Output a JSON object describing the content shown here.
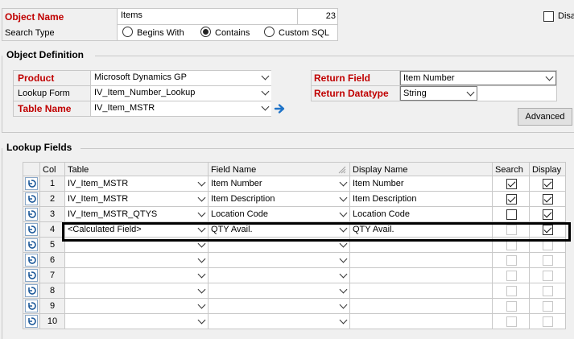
{
  "header": {
    "object_name_label": "Object Name",
    "object_name_value": "Items",
    "object_name_count": "23",
    "search_type_label": "Search Type",
    "search_options": [
      {
        "label": "Begins With",
        "selected": false
      },
      {
        "label": "Contains",
        "selected": true
      },
      {
        "label": "Custom SQL",
        "selected": false
      }
    ],
    "disable_label": "Disa",
    "disable_checked": false
  },
  "object_definition": {
    "title": "Object Definition",
    "product_label": "Product",
    "product_value": "Microsoft Dynamics GP",
    "lookup_form_label": "Lookup Form",
    "lookup_form_value": "IV_Item_Number_Lookup",
    "table_name_label": "Table Name",
    "table_name_value": "IV_Item_MSTR",
    "return_field_label": "Return Field",
    "return_field_value": "Item Number",
    "return_datatype_label": "Return Datatype",
    "return_datatype_value": "String",
    "advanced_label": "Advanced"
  },
  "lookup_fields": {
    "title": "Lookup Fields",
    "columns": {
      "col": "Col",
      "table": "Table",
      "field": "Field Name",
      "display_name": "Display Name",
      "search": "Search",
      "display": "Display"
    },
    "rows": [
      {
        "col": "1",
        "table": "IV_Item_MSTR",
        "field": "Item Number",
        "display_name": "Item Number",
        "search": true,
        "display": true,
        "search_enabled": true
      },
      {
        "col": "2",
        "table": "IV_Item_MSTR",
        "field": "Item Description",
        "display_name": "Item Description",
        "search": true,
        "display": true,
        "search_enabled": true
      },
      {
        "col": "3",
        "table": "IV_Item_MSTR_QTYS",
        "field": "Location Code",
        "display_name": "Location Code",
        "search": false,
        "display": true,
        "search_enabled": true
      },
      {
        "col": "4",
        "table": "<Calculated Field>",
        "field": "QTY Avail.",
        "display_name": "QTY Avail.",
        "search": false,
        "display": true,
        "search_enabled": false
      },
      {
        "col": "5",
        "table": "",
        "field": "",
        "display_name": "",
        "search": false,
        "display": false,
        "search_enabled": false
      },
      {
        "col": "6",
        "table": "",
        "field": "",
        "display_name": "",
        "search": false,
        "display": false,
        "search_enabled": false
      },
      {
        "col": "7",
        "table": "",
        "field": "",
        "display_name": "",
        "search": false,
        "display": false,
        "search_enabled": false
      },
      {
        "col": "8",
        "table": "",
        "field": "",
        "display_name": "",
        "search": false,
        "display": false,
        "search_enabled": false
      },
      {
        "col": "9",
        "table": "",
        "field": "",
        "display_name": "",
        "search": false,
        "display": false,
        "search_enabled": false
      },
      {
        "col": "10",
        "table": "",
        "field": "",
        "display_name": "",
        "search": false,
        "display": false,
        "search_enabled": false
      }
    ]
  },
  "colors": {
    "required_label": "#c00000",
    "arrow_blue": "#1e73c8",
    "highlight_border": "#000000"
  },
  "icons": {
    "row_button": "undo-arrow-icon",
    "table_go": "arrow-right-icon",
    "field_header": "drag-handle-icon"
  }
}
